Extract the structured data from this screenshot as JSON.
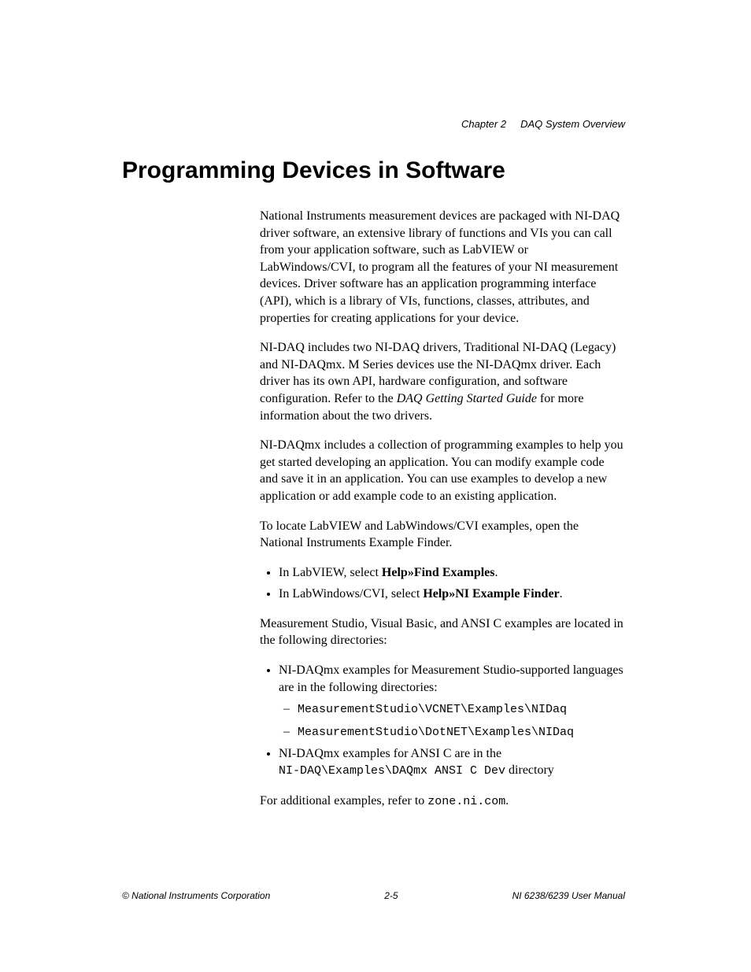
{
  "header": {
    "chapter": "Chapter 2",
    "title": "DAQ System Overview"
  },
  "section_title": "Programming Devices in Software",
  "paragraphs": {
    "p1": "National Instruments measurement devices are packaged with NI-DAQ driver software, an extensive library of functions and VIs you can call from your application software, such as LabVIEW or LabWindows/CVI, to program all the features of your NI measurement devices. Driver software has an application programming interface (API), which is a library of VIs, functions, classes, attributes, and properties for creating applications for your device.",
    "p2_pre": "NI-DAQ includes two NI-DAQ drivers, Traditional NI-DAQ (Legacy) and NI-DAQmx. M Series devices use the NI-DAQmx driver. Each driver has its own API, hardware configuration, and software configuration. Refer to the ",
    "p2_em": "DAQ Getting Started Guide",
    "p2_post": " for more information about the two drivers.",
    "p3": "NI-DAQmx includes a collection of programming examples to help you get started developing an application. You can modify example code and save it in an application. You can use examples to develop a new application or add example code to an existing application.",
    "p4": "To locate LabVIEW and LabWindows/CVI examples, open the National Instruments Example Finder.",
    "p5": "Measurement Studio, Visual Basic, and ANSI C examples are located in the following directories:",
    "p6_pre": "For additional examples, refer to ",
    "p6_mono": "zone.ni.com",
    "p6_post": "."
  },
  "list1": {
    "i1_pre": "In LabVIEW, select ",
    "i1_bold": "Help»Find Examples",
    "i1_post": ".",
    "i2_pre": "In LabWindows/CVI, select ",
    "i2_bold": "Help»NI Example Finder",
    "i2_post": "."
  },
  "list2": {
    "i1": "NI-DAQmx examples for Measurement Studio-supported languages are in the following directories:",
    "i1a": "MeasurementStudio\\VCNET\\Examples\\NIDaq",
    "i1b": "MeasurementStudio\\DotNET\\Examples\\NIDaq",
    "i2_pre": "NI-DAQmx examples for ANSI C are in the ",
    "i2_mono": "NI-DAQ\\Examples\\DAQmx ANSI C Dev",
    "i2_post": " directory"
  },
  "footer": {
    "left": "© National Instruments Corporation",
    "center": "2-5",
    "right": "NI 6238/6239 User Manual"
  }
}
